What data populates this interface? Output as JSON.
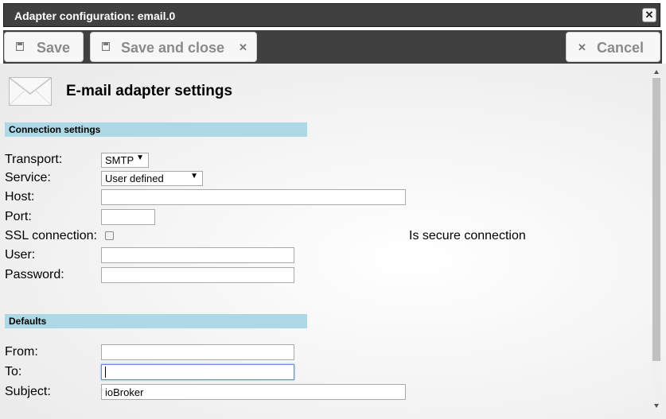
{
  "window": {
    "title": "Adapter configuration: email.0",
    "close_icon": "close-icon"
  },
  "toolbar": {
    "save_label": "Save",
    "save_close_label": "Save and close",
    "cancel_label": "Cancel"
  },
  "page": {
    "heading": "E-mail adapter settings",
    "logo_icon": "envelope-icon"
  },
  "connection": {
    "section_title": "Connection settings",
    "transport_label": "Transport:",
    "transport_value": "SMTP",
    "service_label": "Service:",
    "service_value": "User defined",
    "host_label": "Host:",
    "host_value": "",
    "port_label": "Port:",
    "port_value": "",
    "ssl_label": "SSL connection:",
    "ssl_checked": false,
    "secure_label": "Is secure connection",
    "user_label": "User:",
    "user_value": "",
    "password_label": "Password:",
    "password_value": ""
  },
  "defaults": {
    "section_title": "Defaults",
    "from_label": "From:",
    "from_value": "",
    "to_label": "To:",
    "to_value": "",
    "subject_label": "Subject:",
    "subject_value": "ioBroker"
  }
}
